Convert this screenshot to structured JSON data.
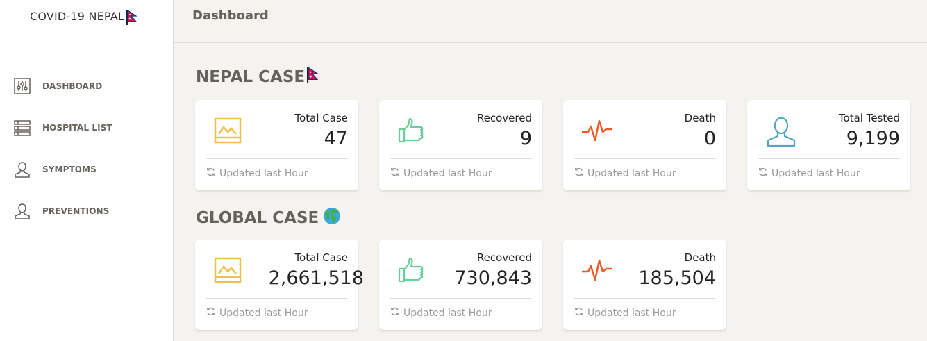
{
  "brand": {
    "title": "COVID-19 NEPAL"
  },
  "header": {
    "title": "Dashboard"
  },
  "sidebar": {
    "items": [
      {
        "label": "DASHBOARD"
      },
      {
        "label": "HOSPITAL LIST"
      },
      {
        "label": "SYMPTOMS"
      },
      {
        "label": "PREVENTIONS"
      }
    ]
  },
  "nepal": {
    "title": "NEPAL CASE",
    "cards": [
      {
        "label": "Total Case",
        "value": "47",
        "footer": "Updated last Hour"
      },
      {
        "label": "Recovered",
        "value": "9",
        "footer": "Updated last Hour"
      },
      {
        "label": "Death",
        "value": "0",
        "footer": "Updated last Hour"
      },
      {
        "label": "Total Tested",
        "value": "9,199",
        "footer": "Updated last Hour"
      }
    ]
  },
  "global": {
    "title": "GLOBAL CASE",
    "cards": [
      {
        "label": "Total Case",
        "value": "2,661,518",
        "footer": "Updated last Hour"
      },
      {
        "label": "Recovered",
        "value": "730,843",
        "footer": "Updated last Hour"
      },
      {
        "label": "Death",
        "value": "185,504",
        "footer": "Updated last Hour"
      }
    ]
  },
  "colors": {
    "total": "#efc050",
    "recovered": "#6bd098",
    "death": "#ef5a27",
    "tested": "#51a6c4",
    "muted": "#9a9a9a",
    "nav": "#66615b"
  }
}
